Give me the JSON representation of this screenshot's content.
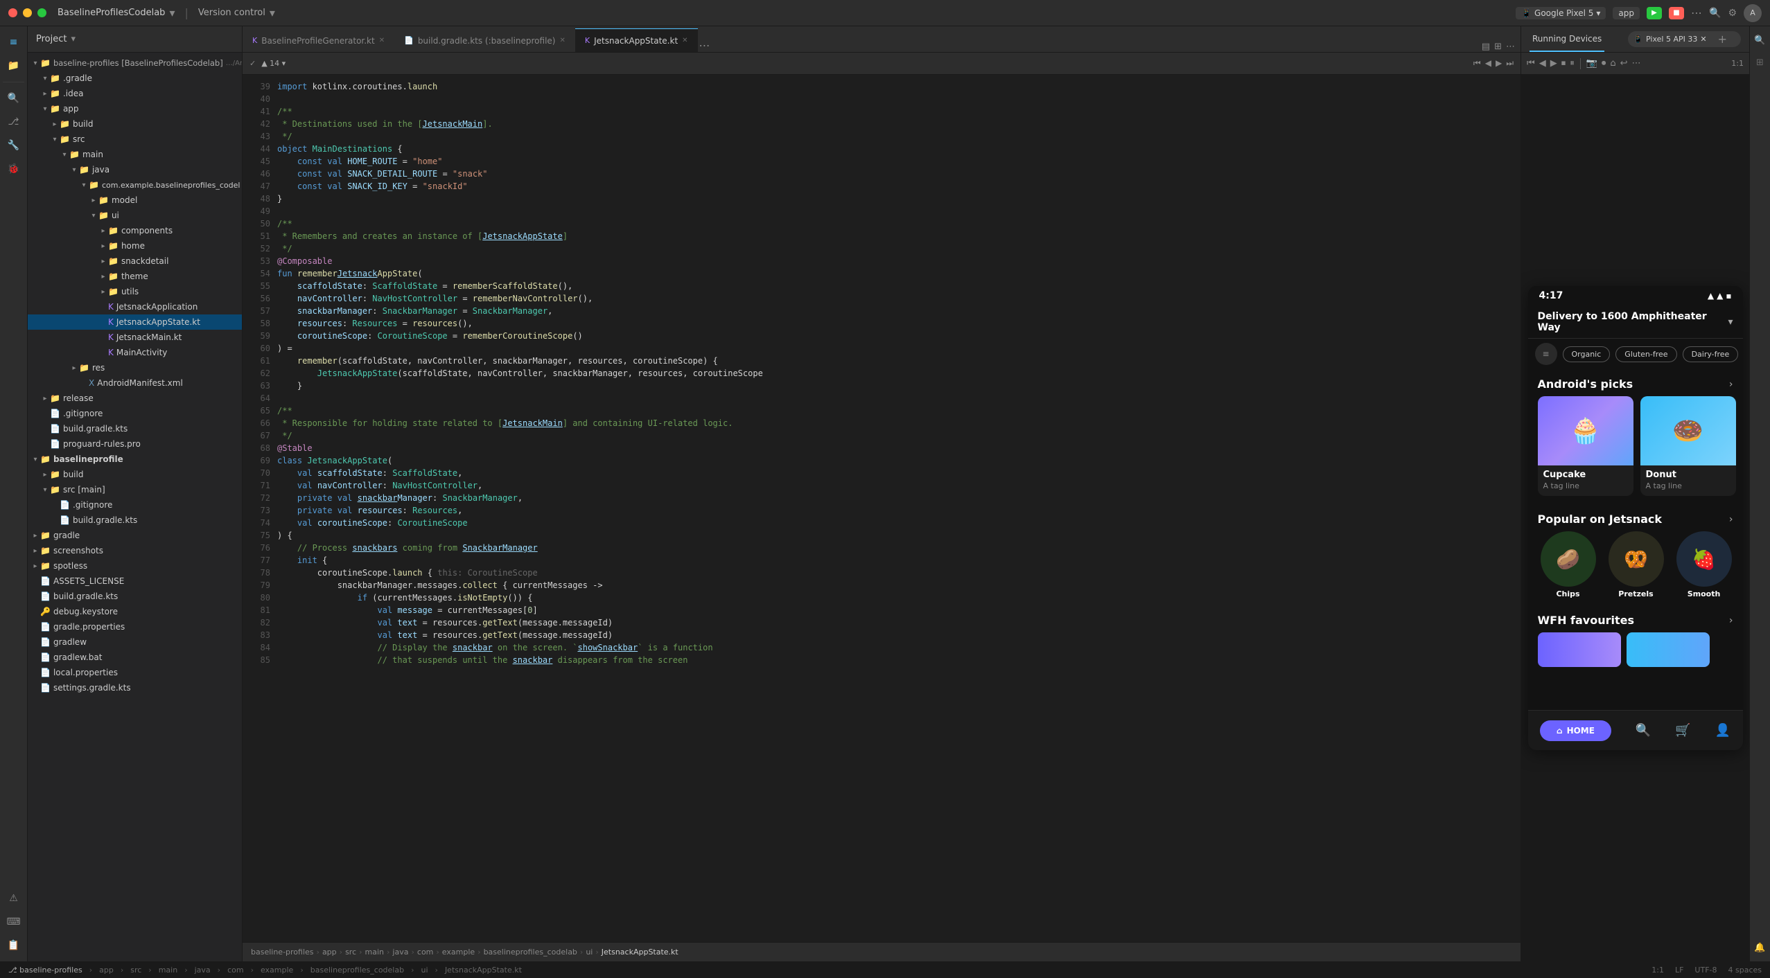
{
  "titlebar": {
    "traffic": [
      "red",
      "yellow",
      "green"
    ],
    "project_label": "BaselineProfilesCodelab",
    "vc_label": "Version control",
    "device_label": "Google Pixel 5",
    "app_label": "app",
    "run_btn_label": "Run",
    "stop_btn_label": "Stop"
  },
  "project": {
    "header": "Project",
    "tree": [
      {
        "indent": 0,
        "arrow": "▾",
        "icon": "📁",
        "label": "baseline-profiles [BaselineProfilesCodelab]",
        "type": "folder"
      },
      {
        "indent": 1,
        "arrow": "▾",
        "icon": "📁",
        "label": ".gradle",
        "type": "folder"
      },
      {
        "indent": 1,
        "arrow": "▸",
        "icon": "📁",
        "label": ".idea",
        "type": "folder"
      },
      {
        "indent": 1,
        "arrow": "▾",
        "icon": "📁",
        "label": "app",
        "type": "folder"
      },
      {
        "indent": 2,
        "arrow": "▸",
        "icon": "📁",
        "label": "build",
        "type": "folder"
      },
      {
        "indent": 2,
        "arrow": "▾",
        "icon": "📁",
        "label": "src",
        "type": "folder"
      },
      {
        "indent": 3,
        "arrow": "▾",
        "icon": "📁",
        "label": "main",
        "type": "folder"
      },
      {
        "indent": 4,
        "arrow": "▾",
        "icon": "📁",
        "label": "java",
        "type": "folder"
      },
      {
        "indent": 5,
        "arrow": "▾",
        "icon": "📁",
        "label": "com.example.baselineprofiles_codel",
        "type": "folder"
      },
      {
        "indent": 6,
        "arrow": "▸",
        "icon": "📁",
        "label": "model",
        "type": "folder"
      },
      {
        "indent": 6,
        "arrow": "▾",
        "icon": "📁",
        "label": "ui",
        "type": "folder"
      },
      {
        "indent": 7,
        "arrow": "▸",
        "icon": "📁",
        "label": "components",
        "type": "folder"
      },
      {
        "indent": 7,
        "arrow": "▸",
        "icon": "📁",
        "label": "home",
        "type": "folder"
      },
      {
        "indent": 7,
        "arrow": "▸",
        "icon": "📁",
        "label": "snackdetail",
        "type": "folder"
      },
      {
        "indent": 7,
        "arrow": "▸",
        "icon": "📁",
        "label": "theme",
        "type": "folder"
      },
      {
        "indent": 7,
        "arrow": "▸",
        "icon": "📁",
        "label": "utils",
        "type": "folder"
      },
      {
        "indent": 7,
        "arrow": "",
        "icon": "🔷",
        "label": "JetsnackApplication",
        "type": "file"
      },
      {
        "indent": 7,
        "arrow": "",
        "icon": "🔷",
        "label": "JetsnackAppState.kt",
        "type": "file",
        "selected": true
      },
      {
        "indent": 7,
        "arrow": "",
        "icon": "🔷",
        "label": "JetsnackMain.kt",
        "type": "file"
      },
      {
        "indent": 7,
        "arrow": "",
        "icon": "🔷",
        "label": "MainActivity",
        "type": "file"
      },
      {
        "indent": 4,
        "arrow": "▸",
        "icon": "📁",
        "label": "res",
        "type": "folder"
      },
      {
        "indent": 5,
        "arrow": "",
        "icon": "📄",
        "label": "AndroidManifest.xml",
        "type": "file"
      },
      {
        "indent": 1,
        "arrow": "▸",
        "icon": "📁",
        "label": "release",
        "type": "folder"
      },
      {
        "indent": 1,
        "arrow": "",
        "icon": "📄",
        "label": ".gitignore",
        "type": "file"
      },
      {
        "indent": 1,
        "arrow": "",
        "icon": "📄",
        "label": "build.gradle.kts",
        "type": "file"
      },
      {
        "indent": 1,
        "arrow": "",
        "icon": "📄",
        "label": "proguard-rules.pro",
        "type": "file"
      },
      {
        "indent": 0,
        "arrow": "▾",
        "icon": "📁",
        "label": "baselineprofile",
        "type": "folder"
      },
      {
        "indent": 1,
        "arrow": "▸",
        "icon": "📁",
        "label": "build",
        "type": "folder"
      },
      {
        "indent": 1,
        "arrow": "▾",
        "icon": "📁",
        "label": "src [main]",
        "type": "folder"
      },
      {
        "indent": 2,
        "arrow": "",
        "icon": "📄",
        "label": ".gitignore",
        "type": "file"
      },
      {
        "indent": 2,
        "arrow": "",
        "icon": "📄",
        "label": "build.gradle.kts",
        "type": "file"
      },
      {
        "indent": 0,
        "arrow": "▸",
        "icon": "📁",
        "label": "gradle",
        "type": "folder"
      },
      {
        "indent": 0,
        "arrow": "▸",
        "icon": "📁",
        "label": "screenshots",
        "type": "folder"
      },
      {
        "indent": 0,
        "arrow": "▸",
        "icon": "📁",
        "label": "spotless",
        "type": "folder"
      },
      {
        "indent": 0,
        "arrow": "",
        "icon": "📄",
        "label": "ASSETS_LICENSE",
        "type": "file"
      },
      {
        "indent": 0,
        "arrow": "",
        "icon": "📄",
        "label": "build.gradle.kts",
        "type": "file"
      },
      {
        "indent": 0,
        "arrow": "",
        "icon": "🔑",
        "label": "debug.keystore",
        "type": "file"
      },
      {
        "indent": 0,
        "arrow": "",
        "icon": "📄",
        "label": "gradle.properties",
        "type": "file"
      },
      {
        "indent": 0,
        "arrow": "",
        "icon": "📄",
        "label": "gradlew",
        "type": "file"
      },
      {
        "indent": 0,
        "arrow": "",
        "icon": "📄",
        "label": "gradlew.bat",
        "type": "file"
      },
      {
        "indent": 0,
        "arrow": "",
        "icon": "📄",
        "label": "local.properties",
        "type": "file"
      },
      {
        "indent": 0,
        "arrow": "",
        "icon": "📄",
        "label": "settings.gradle.kts",
        "type": "file"
      }
    ]
  },
  "editor": {
    "tabs": [
      {
        "label": "BaselineProfileGenerator.kt",
        "active": false
      },
      {
        "label": "build.gradle.kts (:baselineprofile)",
        "active": false
      },
      {
        "label": "JetsnackAppState.kt",
        "active": true
      }
    ],
    "lines_start": 39,
    "code_lines": [
      {
        "num": 39,
        "content": "import kotlinx.coroutines.launch"
      },
      {
        "num": 40,
        "content": ""
      },
      {
        "num": 41,
        "content": "/**"
      },
      {
        "num": 42,
        "content": " * Destinations used in the [JetsnackMain]."
      },
      {
        "num": 43,
        "content": " */"
      },
      {
        "num": 44,
        "content": "object MainDestinations {"
      },
      {
        "num": 45,
        "content": "    const val HOME_ROUTE = \"home\""
      },
      {
        "num": 46,
        "content": "    const val SNACK_DETAIL_ROUTE = \"snack\""
      },
      {
        "num": 47,
        "content": "    const val SNACK_ID_KEY = \"snackId\""
      },
      {
        "num": 48,
        "content": "}"
      },
      {
        "num": 49,
        "content": ""
      },
      {
        "num": 50,
        "content": "/**"
      },
      {
        "num": 51,
        "content": " * Remembers and creates an instance of [JetsnackAppState]"
      },
      {
        "num": 52,
        "content": " */"
      },
      {
        "num": 53,
        "content": "@Composable"
      },
      {
        "num": 54,
        "content": "fun rememberJetsnackAppState("
      },
      {
        "num": 55,
        "content": "    scaffoldState: ScaffoldState = rememberScaffoldState(),"
      },
      {
        "num": 56,
        "content": "    navController: NavHostController = rememberNavController(),"
      },
      {
        "num": 57,
        "content": "    snackbarManager: SnackbarManager = SnackbarManager,"
      },
      {
        "num": 58,
        "content": "    resources: Resources = resources(),"
      },
      {
        "num": 59,
        "content": "    coroutineScope: CoroutineScope = rememberCoroutineScope()"
      },
      {
        "num": 60,
        "content": ") ="
      },
      {
        "num": 61,
        "content": "    remember(scaffoldState, navController, snackbarManager, resources, coroutineScope) {"
      },
      {
        "num": 62,
        "content": "        JetsnackAppState(scaffoldState, navController, snackbarManager, resources, coroutineScope"
      },
      {
        "num": 63,
        "content": "    }"
      },
      {
        "num": 64,
        "content": ""
      },
      {
        "num": 65,
        "content": "/**"
      },
      {
        "num": 66,
        "content": " * Responsible for holding state related to [JetsnackMain] and containing UI-related logic."
      },
      {
        "num": 67,
        "content": " */"
      },
      {
        "num": 68,
        "content": "@Stable"
      },
      {
        "num": 69,
        "content": "class JetsnackAppState("
      },
      {
        "num": 70,
        "content": "    val scaffoldState: ScaffoldState,"
      },
      {
        "num": 71,
        "content": "    val navController: NavHostController,"
      },
      {
        "num": 72,
        "content": "    private val snackbarManager: SnackbarManager,"
      },
      {
        "num": 73,
        "content": "    private val resources: Resources,"
      },
      {
        "num": 74,
        "content": "    val coroutineScope: CoroutineScope"
      },
      {
        "num": 75,
        "content": ") {"
      },
      {
        "num": 76,
        "content": "    // Process snackbars coming from SnackbarManager"
      },
      {
        "num": 77,
        "content": "    init {"
      },
      {
        "num": 78,
        "content": "        coroutineScope.launch { this: CoroutineScope"
      },
      {
        "num": 79,
        "content": "            snackbarManager.messages.collect { currentMessages ->"
      },
      {
        "num": 80,
        "content": "                if (currentMessages.isNotEmpty()) {"
      },
      {
        "num": 81,
        "content": "                    val message = currentMessages[0]"
      },
      {
        "num": 82,
        "content": "                    val text = resources.getText(message.messageId)"
      },
      {
        "num": 83,
        "content": "                    val text = resources.getText(message.messageId)"
      },
      {
        "num": 84,
        "content": "                    // Display the snackbar on the screen. 'showSnackbar' is a function"
      },
      {
        "num": 85,
        "content": "                    // that suspends until the snackbar disappears from the screen"
      }
    ]
  },
  "devices": {
    "running_label": "Running Devices",
    "pixel_label": "Pixel 5 API 33",
    "toolbar_icons": [
      "⏮",
      "◀",
      "▶",
      "⏹",
      "⏸",
      "▣",
      "○",
      "●",
      "⌂",
      "↩",
      "⋯"
    ]
  },
  "phone": {
    "time": "4:17",
    "delivery_text": "Delivery to 1600 Amphitheater Way",
    "filter_chips": [
      "Organic",
      "Gluten-free",
      "Dairy-free"
    ],
    "sections": [
      {
        "title": "Android's picks",
        "cards": [
          {
            "name": "Cupcake",
            "tagline": "A tag line",
            "emoji": "🧁",
            "bg": "cupcake"
          },
          {
            "name": "Donut",
            "tagline": "A tag line",
            "emoji": "🍩",
            "bg": "donut"
          }
        ]
      },
      {
        "title": "Popular on Jetsnack",
        "cards": [
          {
            "name": "Chips",
            "emoji": "🥔"
          },
          {
            "name": "Pretzels",
            "emoji": "🥨"
          },
          {
            "name": "Smooth",
            "emoji": "🍓"
          }
        ]
      },
      {
        "title": "WFH favourites"
      }
    ],
    "nav": [
      "HOME",
      "🔍",
      "🛒",
      "👤"
    ]
  },
  "statusbar": {
    "items": [
      "baseline-profiles",
      "app",
      "src",
      "main",
      "java",
      "com",
      "example",
      "baselineprofiles_codelab",
      "ui",
      "JetsnackAppState.kt"
    ],
    "right_items": [
      "1:1",
      "LF",
      "UTF-8",
      "4 spaces"
    ]
  },
  "sidebar_left_icons": [
    "≡",
    "📁",
    "🔍",
    "⎇",
    "🔧",
    "🐞",
    "🔲",
    "📊",
    "⚡",
    "📱",
    "⚙"
  ],
  "tree_labels": {
    "components_home": "components home",
    "theme": "theme",
    "spotless": "spotless",
    "release": "release",
    "cupcake_tagline": "Cupcake tag line"
  }
}
